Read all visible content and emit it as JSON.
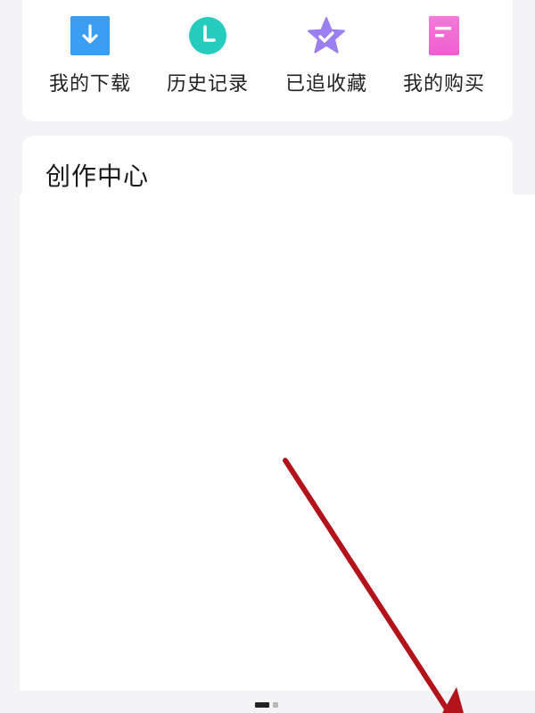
{
  "quick_actions": [
    {
      "label": "我的下载",
      "icon": "download-icon",
      "color": "#3a9df2"
    },
    {
      "label": "历史记录",
      "icon": "clock-icon",
      "color": "#26cdbf"
    },
    {
      "label": "已追收藏",
      "icon": "star-icon",
      "color": "#9b7ff0"
    },
    {
      "label": "我的购买",
      "icon": "document-icon",
      "color": "#f06bd9"
    }
  ],
  "creation_center": {
    "title": "创作中心"
  },
  "annotation": {
    "arrow_color": "#b3141b"
  }
}
